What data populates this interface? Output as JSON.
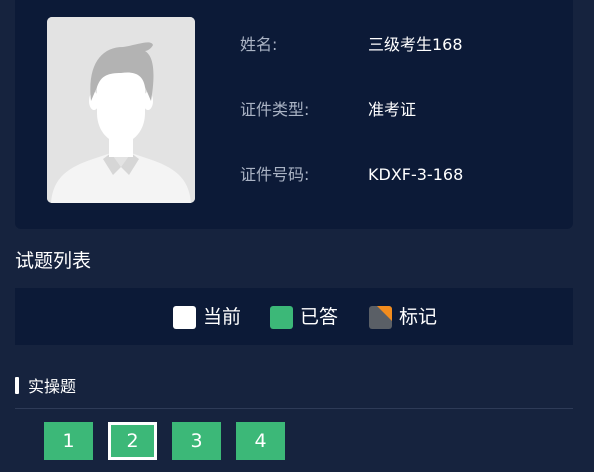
{
  "candidate": {
    "name_label": "姓名:",
    "name_value": "三级考生168",
    "id_type_label": "证件类型:",
    "id_type_value": "准考证",
    "id_number_label": "证件号码:",
    "id_number_value": "KDXF-3-168"
  },
  "question_list": {
    "title": "试题列表",
    "legend": {
      "current": "当前",
      "answered": "已答",
      "marked": "标记"
    },
    "sections": [
      {
        "title": "实操题",
        "questions": [
          {
            "number": "1",
            "state": "answered"
          },
          {
            "number": "2",
            "state": "current"
          },
          {
            "number": "3",
            "state": "answered"
          },
          {
            "number": "4",
            "state": "answered"
          }
        ]
      }
    ]
  },
  "colors": {
    "background": "#16233e",
    "panel": "#0c1a37",
    "answered": "#3cb878",
    "marked_corner": "#f28c1e",
    "marked_base": "#5a5f66",
    "current": "#ffffff"
  },
  "icons": {
    "photo": "user-avatar-placeholder-icon"
  }
}
